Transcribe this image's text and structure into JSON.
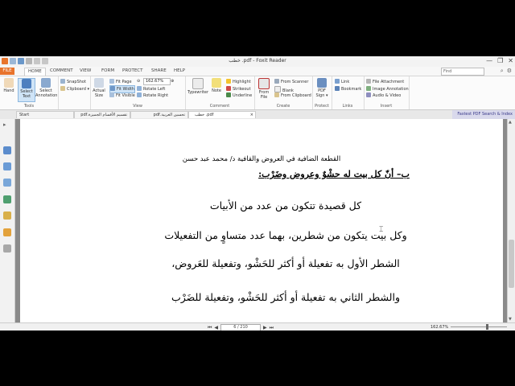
{
  "window": {
    "title": "خطب .pdf - Foxit Reader",
    "controls": [
      "—",
      "❐",
      "✕"
    ]
  },
  "menu": {
    "tabs": [
      "FILE",
      "HOME",
      "COMMENT",
      "VIEW",
      "FORM",
      "PROTECT",
      "SHARE",
      "HELP"
    ],
    "find_placeholder": "Find"
  },
  "ribbon": {
    "tools": {
      "hand": "Hand",
      "select_text": "Select Text",
      "select_annotation": "Select Annotation",
      "label": "Tools"
    },
    "clipboard": {
      "snapshot": "SnapShot",
      "clipboard": "Clipboard ▾"
    },
    "view": {
      "actual_size": "Actual Size",
      "fit_page": "Fit Page",
      "fit_width": "Fit Width",
      "fit_visible": "Fit Visible",
      "zoom": "162.67%",
      "rotate_left": "Rotate Left",
      "rotate_right": "Rotate Right",
      "label": "View"
    },
    "comment": {
      "typewriter": "Typewriter",
      "note": "Note",
      "highlight": "Highlight",
      "strikeout": "Strikeout",
      "underline": "Underline",
      "label": "Comment"
    },
    "create": {
      "from_file": "From File",
      "from_scanner": "From Scanner",
      "blank": "Blank",
      "from_clipboard": "From Clipboard",
      "label": "Create"
    },
    "protect": {
      "pdf_sign": "PDF Sign ▾",
      "label": "Protect"
    },
    "links": {
      "link": "Link",
      "bookmark": "Bookmark",
      "label": "Links"
    },
    "insert": {
      "file_attachment": "File Attachment",
      "image_annotation": "Image Annotation",
      "audio_video": "Audio & Video",
      "label": "Insert"
    }
  },
  "doc_tabs": [
    {
      "label": "Start"
    },
    {
      "label": "تقسيم الأقسام الجميزة.pdf"
    },
    {
      "label": "تحسين العربية.pdf"
    },
    {
      "label": "خطب .pdf"
    }
  ],
  "fastest_banner": "Fastest PDF Search & Index",
  "page": {
    "header": "القطعة الضافية في العروض والقافية د/ محمد عبد حسن",
    "heading": "ب– أنّ كل بيت له حشْوٌ وعروض وضَرْب:",
    "lines": [
      "كل قصيدة تتكون من عدد من الأبيات",
      "وكل بيت يتكون من شطرين، بهما عدد متساوٍ من التفعيلات",
      "الشطر الأول به تفعيلة أو أكثر للحَشْو، وتفعيلة للعَروض،",
      "والشطر الثاني به تفعيلة أو أكثر للحَشْو، وتفعيلة للضَرْب"
    ]
  },
  "status": {
    "page_field": "6 / 210",
    "zoom": "162.67%"
  }
}
